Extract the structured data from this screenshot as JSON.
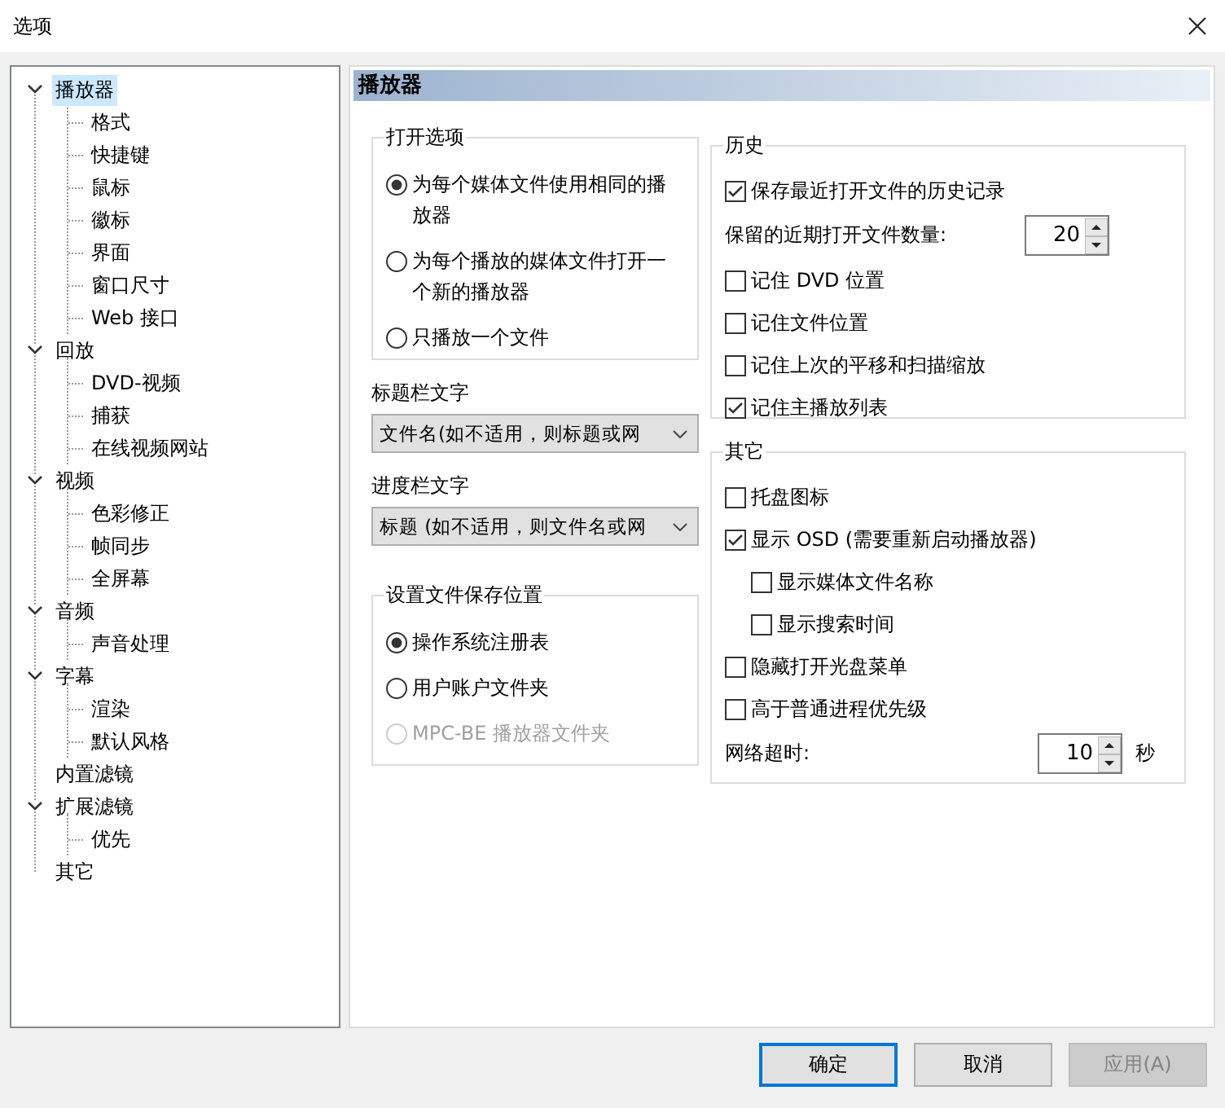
{
  "window": {
    "title": "选项"
  },
  "tree": [
    {
      "label": "播放器",
      "selected": true,
      "expanded": true,
      "children": [
        {
          "label": "格式",
          "selected": false
        },
        {
          "label": "快捷键",
          "selected": false
        },
        {
          "label": "鼠标",
          "selected": false
        },
        {
          "label": "徽标",
          "selected": false
        },
        {
          "label": "界面",
          "selected": false
        },
        {
          "label": "窗口尺寸",
          "selected": false
        },
        {
          "label": "Web 接口",
          "selected": false
        }
      ]
    },
    {
      "label": "回放",
      "selected": false,
      "expanded": true,
      "children": [
        {
          "label": "DVD-视频",
          "selected": false
        },
        {
          "label": "捕获",
          "selected": false
        },
        {
          "label": "在线视频网站",
          "selected": false
        }
      ]
    },
    {
      "label": "视频",
      "selected": false,
      "expanded": true,
      "children": [
        {
          "label": "色彩修正",
          "selected": false
        },
        {
          "label": "帧同步",
          "selected": false
        },
        {
          "label": "全屏幕",
          "selected": false
        }
      ]
    },
    {
      "label": "音频",
      "selected": false,
      "expanded": true,
      "children": [
        {
          "label": "声音处理",
          "selected": false
        }
      ]
    },
    {
      "label": "字幕",
      "selected": false,
      "expanded": true,
      "children": [
        {
          "label": "渲染",
          "selected": false
        },
        {
          "label": "默认风格",
          "selected": false
        }
      ]
    },
    {
      "label": "内置滤镜",
      "selected": false
    },
    {
      "label": "扩展滤镜",
      "selected": false,
      "expanded": true,
      "children": [
        {
          "label": "优先",
          "selected": false
        }
      ]
    },
    {
      "label": "其它",
      "selected": false
    }
  ],
  "page": {
    "heading": "播放器"
  },
  "open_options": {
    "title": "打开选项",
    "options": [
      {
        "label": "为每个媒体文件使用相同的播放器",
        "selected": true,
        "disabled": false
      },
      {
        "label": "为每个播放的媒体文件打开一个新的播放器",
        "selected": false,
        "disabled": false
      },
      {
        "label": "只播放一个文件",
        "selected": false,
        "disabled": false
      }
    ]
  },
  "title_bar_text": {
    "label": "标题栏文字",
    "value": "文件名(如不适用，则标题或网"
  },
  "progress_bar_text": {
    "label": "进度栏文字",
    "value": "标题 (如不适用，则文件名或网"
  },
  "settings_location": {
    "title": "设置文件保存位置",
    "options": [
      {
        "label": "操作系统注册表",
        "selected": true,
        "disabled": false
      },
      {
        "label": "用户账户文件夹",
        "selected": false,
        "disabled": false
      },
      {
        "label": "MPC-BE 播放器文件夹",
        "selected": false,
        "disabled": true
      }
    ]
  },
  "history": {
    "title": "历史",
    "items": [
      {
        "kind": "checkbox",
        "label": "保存最近打开文件的历史记录",
        "checked": true
      },
      {
        "kind": "spin",
        "label": "保留的近期打开文件数量:",
        "value": "20"
      },
      {
        "kind": "checkbox",
        "label": "记住 DVD 位置",
        "checked": false
      },
      {
        "kind": "checkbox",
        "label": "记住文件位置",
        "checked": false
      },
      {
        "kind": "checkbox",
        "label": "记住上次的平移和扫描缩放",
        "checked": false
      },
      {
        "kind": "checkbox",
        "label": "记住主播放列表",
        "checked": true
      }
    ]
  },
  "other": {
    "title": "其它",
    "items": [
      {
        "kind": "checkbox",
        "label": "托盘图标",
        "checked": false
      },
      {
        "kind": "checkbox",
        "label": "显示 OSD (需要重新启动播放器)",
        "checked": true,
        "children": [
          {
            "kind": "checkbox",
            "label": "显示媒体文件名称",
            "checked": false
          },
          {
            "kind": "checkbox",
            "label": "显示搜索时间",
            "checked": false
          }
        ]
      },
      {
        "kind": "checkbox",
        "label": "隐藏打开光盘菜单",
        "checked": false
      },
      {
        "kind": "checkbox",
        "label": "高于普通进程优先级",
        "checked": false
      },
      {
        "kind": "spin",
        "label": "网络超时:",
        "value": "10",
        "unit": "秒"
      }
    ]
  },
  "buttons": [
    {
      "label": "确定",
      "kind": "default",
      "disabled": false
    },
    {
      "label": "取消",
      "kind": "normal",
      "disabled": false
    },
    {
      "label": "应用(A)",
      "kind": "normal",
      "disabled": true
    }
  ]
}
